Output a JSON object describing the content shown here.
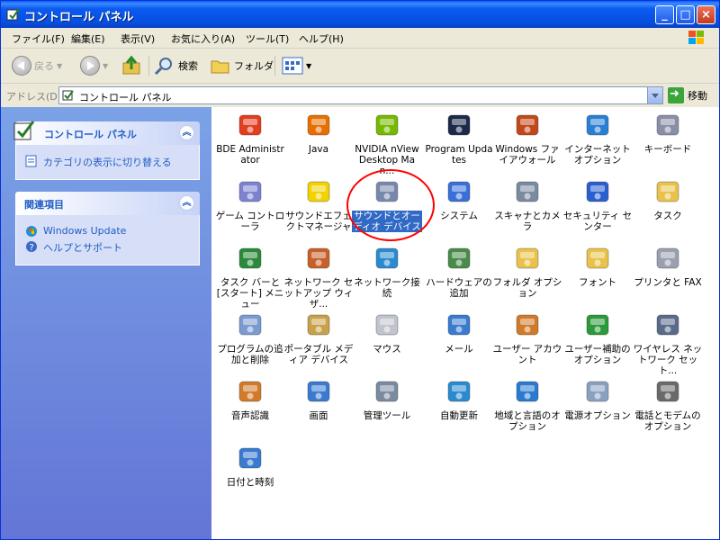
{
  "window": {
    "title": "コントロール パネル"
  },
  "menu": [
    "ファイル(F)",
    "編集(E)",
    "表示(V)",
    "お気に入り(A)",
    "ツール(T)",
    "ヘルプ(H)"
  ],
  "toolbar": {
    "back": "戻る",
    "search": "検索",
    "folders": "フォルダ"
  },
  "address": {
    "label": "アドレス(D)",
    "value": "コントロール パネル",
    "go": "移動"
  },
  "taskpane": {
    "panel1": {
      "title": "コントロール パネル",
      "link": "カテゴリの表示に切り替える"
    },
    "panel2": {
      "title": "関連項目",
      "links": [
        "Windows Update",
        "ヘルプとサポート"
      ]
    }
  },
  "items": [
    {
      "label": "BDE Administrator",
      "icon": "bde-admin-icon",
      "color": "#e43c1f"
    },
    {
      "label": "Java",
      "icon": "java-icon",
      "color": "#e76f00"
    },
    {
      "label": "NVIDIA nView Desktop Man...",
      "icon": "nvidia-icon",
      "color": "#76b900"
    },
    {
      "label": "Program Updates",
      "icon": "program-updates-icon",
      "color": "#1c2a4a"
    },
    {
      "label": "Windows ファイアウォール",
      "icon": "firewall-icon",
      "color": "#c2481b"
    },
    {
      "label": "インターネット オプション",
      "icon": "internet-options-icon",
      "color": "#2a7fd4"
    },
    {
      "label": "キーボード",
      "icon": "keyboard-icon",
      "color": "#8a8fa8"
    },
    {
      "label": "ゲーム コントローラ",
      "icon": "game-controller-icon",
      "color": "#7c82d0"
    },
    {
      "label": "サウンドエフェクトマネージャ",
      "icon": "sound-effect-manager-icon",
      "color": "#f2d200"
    },
    {
      "label": "サウンドとオーディオ デバイス",
      "icon": "sound-audio-devices-icon",
      "color": "#4a5f8f"
    },
    {
      "label": "システム",
      "icon": "system-icon",
      "color": "#3a6fd8"
    },
    {
      "label": "スキャナとカメラ",
      "icon": "scanner-camera-icon",
      "color": "#7a8aa0"
    },
    {
      "label": "セキュリティ センター",
      "icon": "security-center-icon",
      "color": "#2a5fd0"
    },
    {
      "label": "タスク",
      "icon": "tasks-icon",
      "color": "#e8c24a"
    },
    {
      "label": "タスク バーと [スタート] メニュー",
      "icon": "taskbar-start-icon",
      "color": "#2a8a3a"
    },
    {
      "label": "ネットワーク セットアップ ウィザ...",
      "icon": "network-setup-icon",
      "color": "#c8602a"
    },
    {
      "label": "ネットワーク接続",
      "icon": "network-connections-icon",
      "color": "#2a8ad0"
    },
    {
      "label": "ハードウェアの追加",
      "icon": "add-hardware-icon",
      "color": "#4a8a4a"
    },
    {
      "label": "フォルダ オプション",
      "icon": "folder-options-icon",
      "color": "#e8c24a"
    },
    {
      "label": "フォント",
      "icon": "fonts-icon",
      "color": "#e8c24a"
    },
    {
      "label": "プリンタと FAX",
      "icon": "printers-fax-icon",
      "color": "#9aa0b0"
    },
    {
      "label": "プログラムの追加と削除",
      "icon": "add-remove-programs-icon",
      "color": "#7a9ad0"
    },
    {
      "label": "ポータブル メディア デバイス",
      "icon": "portable-media-icon",
      "color": "#c8a24a"
    },
    {
      "label": "マウス",
      "icon": "mouse-icon",
      "color": "#c0c4cc"
    },
    {
      "label": "メール",
      "icon": "mail-icon",
      "color": "#3a7ad0"
    },
    {
      "label": "ユーザー アカウント",
      "icon": "user-accounts-icon",
      "color": "#d07a2a"
    },
    {
      "label": "ユーザー補助のオプション",
      "icon": "accessibility-icon",
      "color": "#2a9a3a"
    },
    {
      "label": "ワイヤレス ネットワーク セット...",
      "icon": "wireless-network-icon",
      "color": "#5a6a8a"
    },
    {
      "label": "音声認識",
      "icon": "speech-icon",
      "color": "#d07a2a"
    },
    {
      "label": "画面",
      "icon": "display-icon",
      "color": "#3a7ad0"
    },
    {
      "label": "管理ツール",
      "icon": "admin-tools-icon",
      "color": "#7a8aa0"
    },
    {
      "label": "自動更新",
      "icon": "automatic-updates-icon",
      "color": "#2a8ad0"
    },
    {
      "label": "地域と言語のオプション",
      "icon": "regional-language-icon",
      "color": "#2a7ad0"
    },
    {
      "label": "電源オプション",
      "icon": "power-options-icon",
      "color": "#8aa0c0"
    },
    {
      "label": "電話とモデムのオプション",
      "icon": "phone-modem-icon",
      "color": "#6a6a6a"
    },
    {
      "label": "日付と時刻",
      "icon": "date-time-icon",
      "color": "#3a7ad0"
    }
  ],
  "selected_item": "サウンドとオーディオ デバイス"
}
